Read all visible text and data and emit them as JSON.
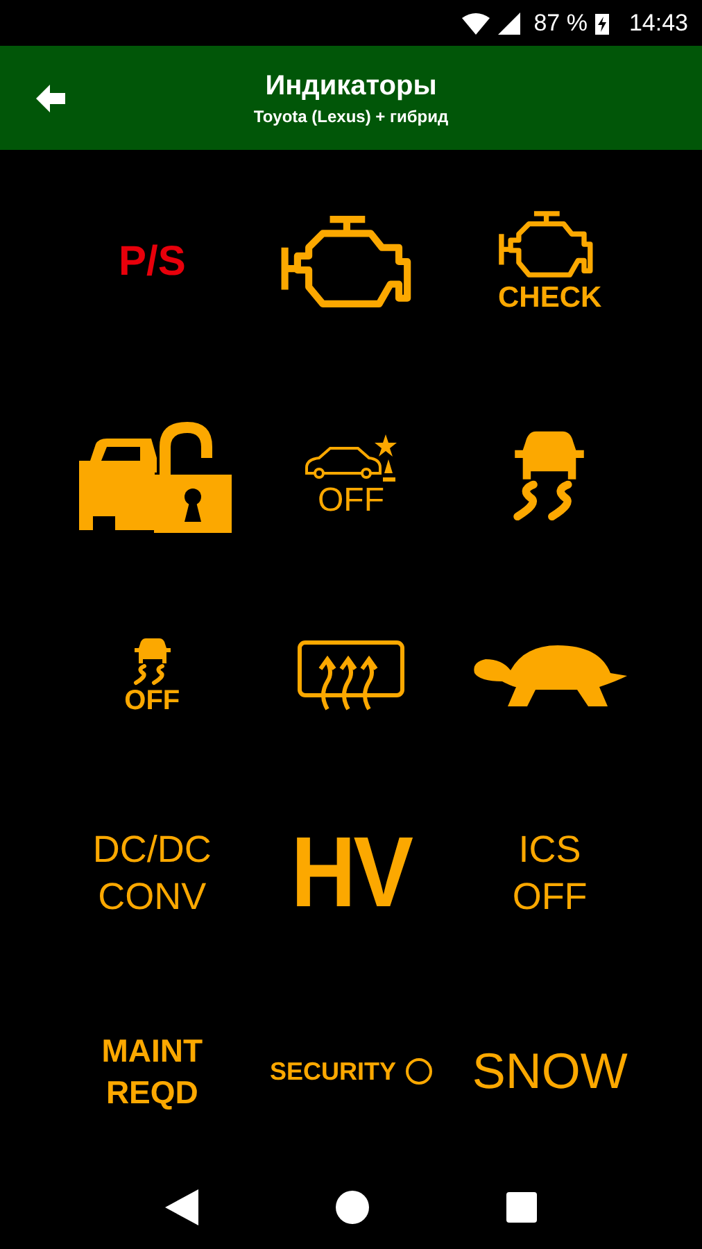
{
  "status_bar": {
    "battery": "87 %",
    "time": "14:43"
  },
  "header": {
    "title": "Индикаторы",
    "subtitle": "Toyota (Lexus) + гибрид"
  },
  "indicators": [
    {
      "kind": "code",
      "lines": [
        "P/S"
      ],
      "color": "#e8000b"
    },
    {
      "kind": "engine"
    },
    {
      "kind": "engine",
      "caption": "CHECK"
    },
    {
      "kind": "carlock"
    },
    {
      "kind": "sensor",
      "caption": "OFF"
    },
    {
      "kind": "skid"
    },
    {
      "kind": "skidsmall",
      "caption": "OFF"
    },
    {
      "kind": "defrost"
    },
    {
      "kind": "turtle"
    },
    {
      "kind": "plain",
      "lines": [
        "DC/DC",
        "CONV"
      ],
      "color": "#fca800"
    },
    {
      "kind": "huge",
      "lines": [
        "HV"
      ],
      "color": "#fca800"
    },
    {
      "kind": "plain",
      "lines": [
        "ICS",
        "OFF"
      ],
      "color": "#fca800"
    },
    {
      "kind": "bold",
      "lines": [
        "MAINT",
        "REQD"
      ],
      "color": "#fca800"
    },
    {
      "kind": "security",
      "lines": [
        "SECURITY"
      ],
      "color": "#fca800"
    },
    {
      "kind": "wide",
      "lines": [
        "SNOW"
      ],
      "color": "#fca800"
    }
  ]
}
